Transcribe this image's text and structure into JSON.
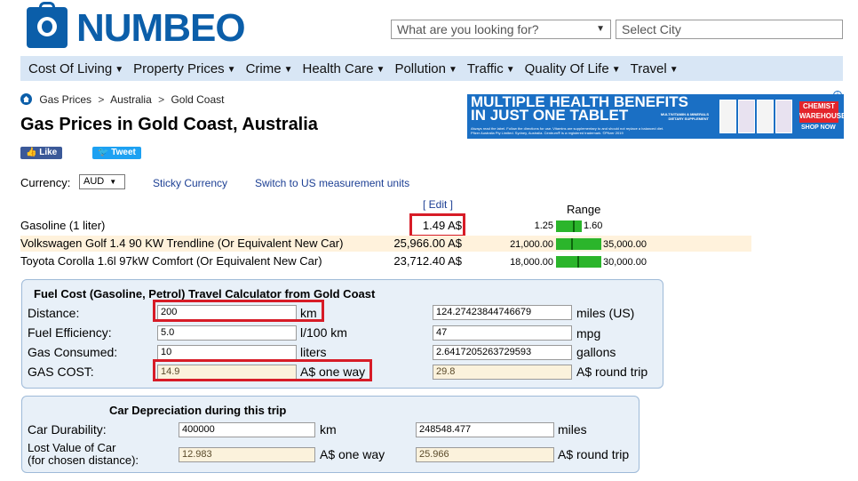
{
  "header": {
    "logo_text": "NUMBEO",
    "search_placeholder": "What are you looking for?",
    "city_placeholder": "Select City"
  },
  "nav": {
    "items": [
      "Cost Of Living",
      "Property Prices",
      "Crime",
      "Health Care",
      "Pollution",
      "Traffic",
      "Quality Of Life",
      "Travel"
    ]
  },
  "breadcrumb": {
    "items": [
      "Gas Prices",
      "Australia",
      "Gold Coast"
    ],
    "separator": ">"
  },
  "page": {
    "title": "Gas Prices in Gold Coast, Australia",
    "like_label": "Like",
    "tweet_label": "Tweet"
  },
  "ad": {
    "headline1": "MULTIPLE HEALTH BENEFITS",
    "headline2": "IN JUST ONE TABLET",
    "subline": "MULTIVITAMIN & MINERALS DIETARY SUPPLEMENT",
    "fine_print": "Always read the label. Follow the directions for use. Vitamins are supplementary to and should not replace a balanced diet. Pfizer Australia Pty Limited. Sydney, Australia. Centrum® is a registered trademark. ©Pfizer 2019",
    "brand": "CHEMIST WAREHOUSE",
    "cta": "SHOP NOW",
    "colors": {
      "background": "#1a6fc4",
      "brand": "#e3242b"
    }
  },
  "currency": {
    "label": "Currency:",
    "selected": "AUD",
    "sticky_label": "Sticky Currency",
    "switch_units_label": "Switch to US measurement units"
  },
  "prices": {
    "edit_label": "[ Edit ]",
    "range_label": "Range",
    "rows": [
      {
        "name": "Gasoline (1 liter)",
        "value": "1.49 A$",
        "min": "1.25",
        "max": "1.60",
        "position": 0.69
      },
      {
        "name": "Volkswagen Golf 1.4 90 KW Trendline (Or Equivalent New Car)",
        "value": "25,966.00 A$",
        "min": "21,000.00",
        "max": "35,000.00",
        "position": 0.35
      },
      {
        "name": "Toyota Corolla 1.6l 97kW Comfort (Or Equivalent New Car)",
        "value": "23,712.40 A$",
        "min": "18,000.00",
        "max": "30,000.00",
        "position": 0.48
      }
    ]
  },
  "fuel_calc": {
    "title": "Fuel Cost (Gasoline, Petrol) Travel Calculator from Gold Coast",
    "distance": {
      "label": "Distance:",
      "value": "200",
      "unit": "km",
      "alt_value": "124.27423844746679",
      "alt_unit": "miles (US)"
    },
    "efficiency": {
      "label": "Fuel Efficiency:",
      "value": "5.0",
      "unit": "l/100 km",
      "alt_value": "47",
      "alt_unit": "mpg"
    },
    "consumed": {
      "label": "Gas Consumed:",
      "value": "10",
      "unit": "liters",
      "alt_value": "2.6417205263729593",
      "alt_unit": "gallons"
    },
    "cost": {
      "label": "GAS COST:",
      "value": "14.9",
      "unit": "A$ one way",
      "alt_value": "29.8",
      "alt_unit": "A$ round trip"
    }
  },
  "depreciation_calc": {
    "title": "Car Depreciation during this trip",
    "durability": {
      "label": "Car Durability:",
      "value": "400000",
      "unit": "km",
      "alt_value": "248548.477",
      "alt_unit": "miles"
    },
    "lost_value": {
      "label_line1": "Lost Value of Car",
      "label_line2": "(for chosen distance):",
      "value": "12.983",
      "unit": "A$ one way",
      "alt_value": "25.966",
      "alt_unit": "A$ round trip"
    }
  },
  "colors": {
    "brand_blue": "#0b5ea9",
    "nav_bg": "#d8e6f5",
    "highlight_row": "#fff2dc",
    "range_bar": "#2bb52b",
    "callout_red": "#d71c27"
  }
}
